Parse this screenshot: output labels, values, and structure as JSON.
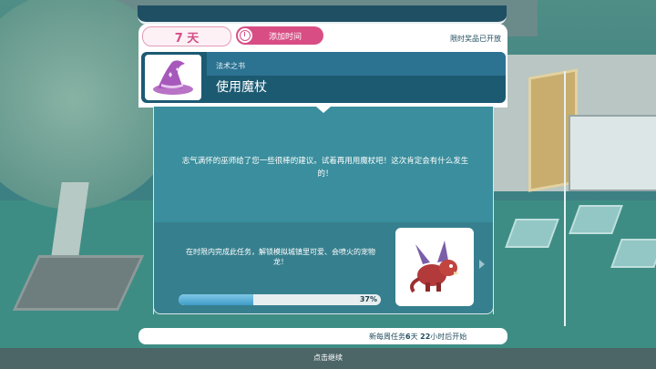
{
  "timer": {
    "days_label": "7 天",
    "add_time_label": "添加时间",
    "reward_notice": "限时奖品已开放"
  },
  "task": {
    "subtitle": "法术之书",
    "title": "使用魔杖",
    "icon": "wizard-hat-icon",
    "description": "志气满怀的巫师给了您一些很棒的建议。试着再用用魔杖吧！这次肯定会有什么发生的！"
  },
  "reward": {
    "description": "在时限内完成此任务，解锁模拟城镇里可爱、会喷火的宠物龙！",
    "icon": "dragon-pet-icon",
    "progress_percent": 37,
    "progress_label": "37%"
  },
  "weekly": {
    "prefix": "新每周任务",
    "days": "6",
    "days_unit": "天",
    "hours": "22",
    "suffix": "小时后开始"
  },
  "footer": {
    "continue_label": "点击继续"
  },
  "colors": {
    "accent_pink": "#d84e84",
    "header_blue": "#1c5a72",
    "panel_teal": "#3a8e9d",
    "progress_blue": "#3f9cc8"
  }
}
